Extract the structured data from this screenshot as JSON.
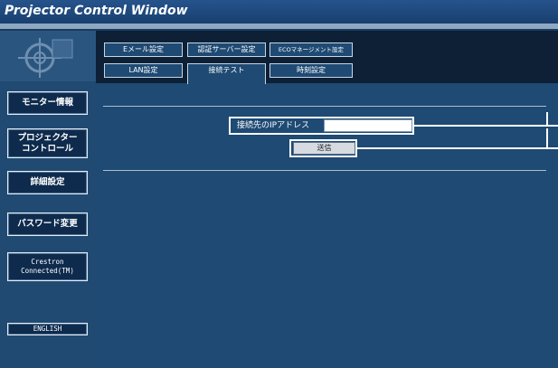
{
  "window": {
    "title": "Projector Control Window"
  },
  "sidebar": {
    "items": [
      {
        "id": "monitor-info",
        "label": "モニター情報"
      },
      {
        "id": "projector-control",
        "label": "プロジェクター\nコントロール"
      },
      {
        "id": "detailed-settings",
        "label": "詳細設定"
      },
      {
        "id": "password-change",
        "label": "パスワード変更"
      },
      {
        "id": "crestron",
        "label": "Crestron\nConnected(TM)"
      },
      {
        "id": "english",
        "label": "ENGLISH"
      }
    ]
  },
  "tabs": {
    "row1": [
      {
        "id": "email",
        "label": "Eメール設定"
      },
      {
        "id": "auth-server",
        "label": "認証サーバー設定"
      },
      {
        "id": "eco",
        "label": "ECOマネージメント設定"
      }
    ],
    "row2": [
      {
        "id": "lan",
        "label": "LAN設定"
      },
      {
        "id": "connection-test",
        "label": "接続テスト",
        "active": true
      },
      {
        "id": "time",
        "label": "時刻設定"
      }
    ]
  },
  "form": {
    "ip_label": "接続先のIPアドレス",
    "ip_value": "",
    "send_label": "送信"
  },
  "colors": {
    "titlebar": "#18406f",
    "sidebar": "#204a72",
    "main": "#1e4a73",
    "button": "#0e2b4d"
  }
}
